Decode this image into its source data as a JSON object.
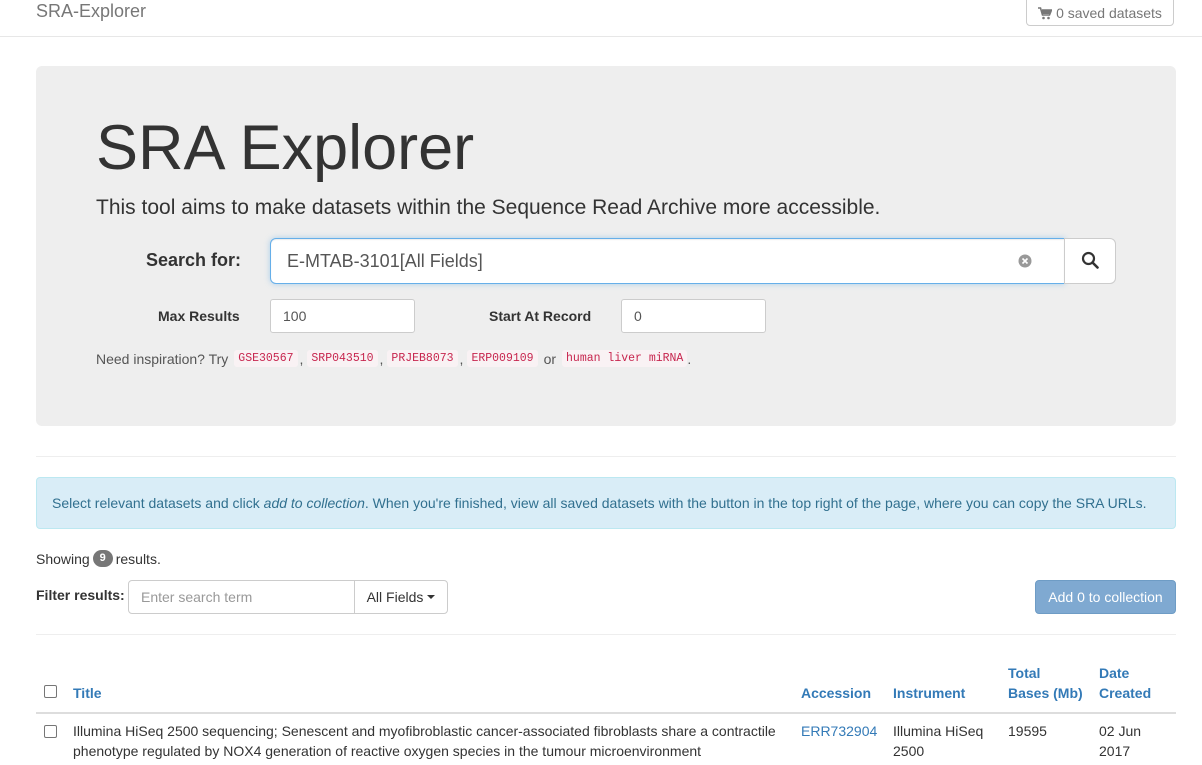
{
  "navbar": {
    "brand": "SRA-Explorer",
    "saved_label": "0 saved datasets"
  },
  "hero": {
    "title": "SRA Explorer",
    "lead": "This tool aims to make datasets within the Sequence Read Archive more accessible."
  },
  "search": {
    "label": "Search for:",
    "value": "E-MTAB-3101[All Fields]",
    "max_results_label": "Max Results",
    "max_results_value": "100",
    "start_label": "Start At Record",
    "start_value": "0"
  },
  "inspiration": {
    "prefix": "Need inspiration? Try",
    "examples": [
      "GSE30567",
      "SRP043510",
      "PRJEB8073",
      "ERP009109"
    ],
    "or": "or",
    "last_example": "human liver miRNA",
    "suffix": "."
  },
  "alert": {
    "part1": "Select relevant datasets and click",
    "emphasis": "add to collection",
    "part2": ". When you're finished, view all saved datasets with the button in the top right of the page, where you can copy the SRA URLs."
  },
  "results": {
    "showing_prefix": "Showing",
    "count": "9",
    "showing_suffix": "results."
  },
  "filter": {
    "label": "Filter results:",
    "placeholder": "Enter search term",
    "field_select": "All Fields",
    "add_button": "Add 0 to collection"
  },
  "table": {
    "headers": {
      "title": "Title",
      "accession": "Accession",
      "instrument": "Instrument",
      "bases_line1": "Total",
      "bases_line2": "Bases (Mb)",
      "date_line1": "Date",
      "date_line2": "Created"
    },
    "rows": [
      {
        "title_line1": "Illumina HiSeq 2500 sequencing; Senescent and myofibroblastic cancer-associated fibroblasts share a contractile",
        "title_line2": "phenotype regulated by NOX4 generation of reactive oxygen species in the tumour microenvironment",
        "accession": "ERR732904",
        "instrument_line1": "Illumina HiSeq",
        "instrument_line2": "2500",
        "bases": "19595",
        "date_line1": "02 Jun",
        "date_line2": "2017"
      }
    ]
  },
  "colors": {
    "link": "#337ab7",
    "alert_bg": "#d9edf7",
    "code": "#c7254e",
    "jumbotron": "#eeeeee"
  }
}
